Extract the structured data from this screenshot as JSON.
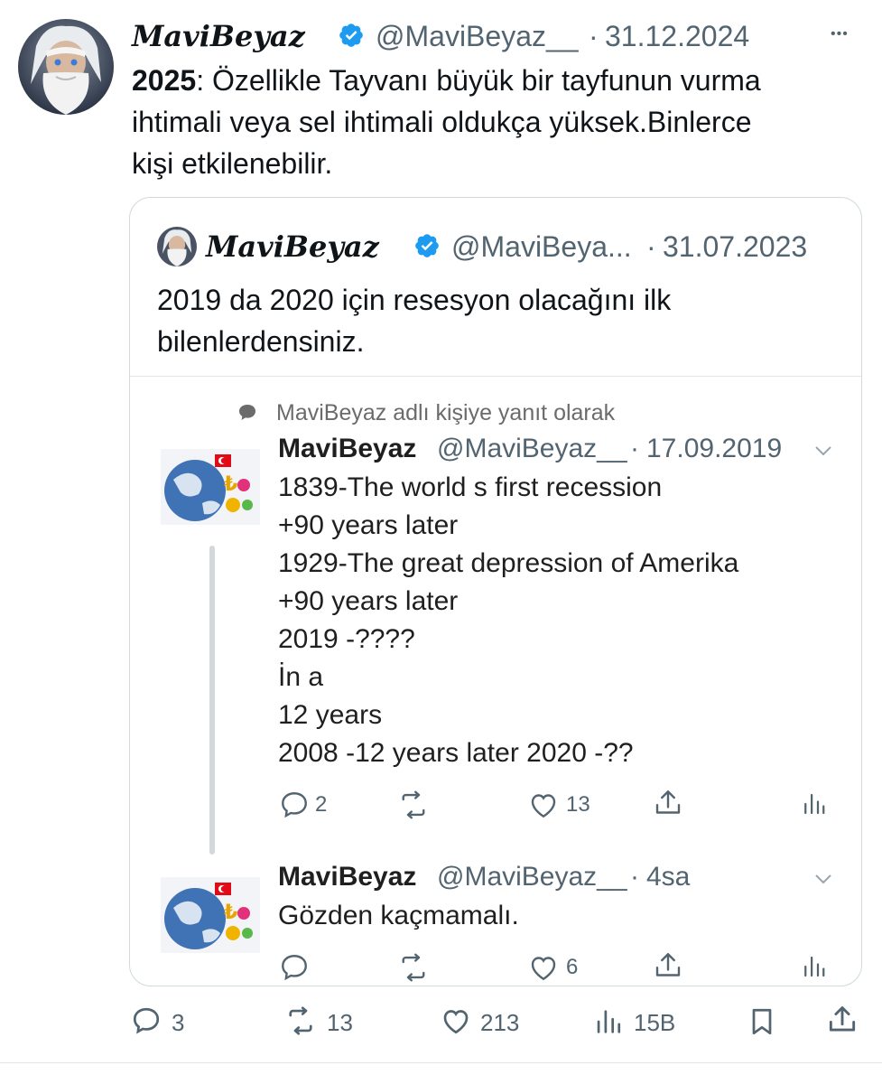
{
  "tweet": {
    "display_name": "MaviBeyaz",
    "handle": "@MaviBeyaz__",
    "dot": "·",
    "date": "31.12.2024",
    "more": "•••",
    "text_bold": "2025",
    "text_lines": [
      ": Özellikle Tayvanı büyük bir tayfunun vurma",
      "ihtimali veya sel ihtimali oldukça yüksek.Binlerce",
      "kişi etkilenebilir."
    ]
  },
  "quote": {
    "display_name": "MaviBeyaz",
    "handle": "@MaviBeya...",
    "dot": "·",
    "date": "31.07.2023",
    "text_lines": [
      "2019 da 2020 için resesyon olacağını ilk",
      "bilenlerdensiniz."
    ],
    "reply_context": "MaviBeyaz adlı kişiye yanıt olarak",
    "thread": [
      {
        "name": "MaviBeyaz",
        "handle": "@MaviBeyaz__",
        "dot": "·",
        "date": "17.09.2019",
        "lines": [
          "1839-The world s first recession",
          "+90 years later",
          "1929-The great depression of Amerika",
          "+90 years later",
          "2019 -????",
          "İn a",
          "12 years",
          "2008 -12 years later 2020 -??"
        ],
        "replies": "2",
        "retweets": "",
        "likes": "13"
      },
      {
        "name": "MaviBeyaz",
        "handle": "@MaviBeyaz__",
        "dot": "·",
        "date": "4sa",
        "lines": [
          "Gözden kaçmamalı."
        ],
        "replies": "",
        "retweets": "",
        "likes": "6"
      }
    ]
  },
  "actions": {
    "replies": "3",
    "retweets": "13",
    "likes": "213",
    "views": "15B"
  },
  "icons": {
    "verified": "verified-badge-icon",
    "reply": "reply-icon",
    "retweet": "retweet-icon",
    "like": "heart-icon",
    "views": "views-icon",
    "bookmark": "bookmark-icon",
    "share": "share-icon"
  },
  "colors": {
    "verified_blue": "#1d9bf0",
    "text": "#0f1419",
    "muted": "#536471",
    "border": "#cfd9de"
  }
}
